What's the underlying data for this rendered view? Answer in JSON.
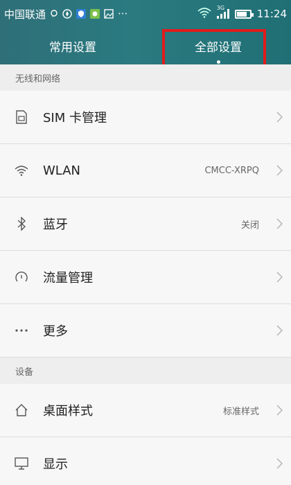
{
  "status_bar": {
    "carrier": "中国联通",
    "more": "···",
    "network": "3G",
    "time": "11:24"
  },
  "tabs": [
    {
      "label": "常用设置"
    },
    {
      "label": "全部设置"
    }
  ],
  "sections": [
    {
      "header": "无线和网络",
      "items": [
        {
          "label": "SIM 卡管理",
          "value": "",
          "icon": "sim-card-icon"
        },
        {
          "label": "WLAN",
          "value": "CMCC-XRPQ",
          "icon": "wifi-icon"
        },
        {
          "label": "蓝牙",
          "value": "关闭",
          "icon": "bluetooth-icon"
        },
        {
          "label": "流量管理",
          "value": "",
          "icon": "data-usage-icon"
        },
        {
          "label": "更多",
          "value": "",
          "icon": "more-icon"
        }
      ]
    },
    {
      "header": "设备",
      "items": [
        {
          "label": "桌面样式",
          "value": "标准样式",
          "icon": "home-icon"
        },
        {
          "label": "显示",
          "value": "",
          "icon": "display-icon"
        }
      ]
    }
  ],
  "colors": {
    "header_bg": "#2a7a80",
    "highlight": "#e01b1b"
  }
}
